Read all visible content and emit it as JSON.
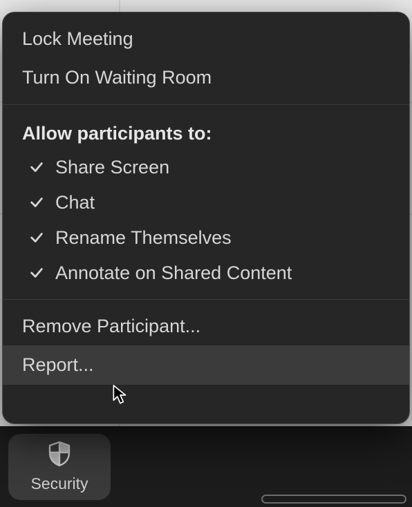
{
  "menu": {
    "lock_meeting": "Lock Meeting",
    "waiting_room": "Turn On Waiting Room",
    "allow_header": "Allow participants to:",
    "options": [
      {
        "label": "Share Screen",
        "checked": true
      },
      {
        "label": "Chat",
        "checked": true
      },
      {
        "label": "Rename Themselves",
        "checked": true
      },
      {
        "label": "Annotate on Shared Content",
        "checked": true
      }
    ],
    "remove_participant": "Remove Participant...",
    "report": "Report..."
  },
  "toolbar": {
    "security_label": "Security"
  }
}
